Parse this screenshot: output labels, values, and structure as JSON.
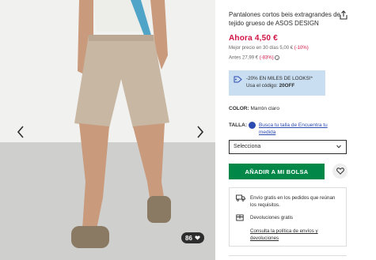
{
  "product": {
    "title": "Pantalones cortos beis extragrandes de tejido grueso de ASOS DESIGN",
    "price_now": "Ahora 4,50 €",
    "best_price_label": "Mejor precio en 30 días 5,00 € ",
    "best_price_pct": "(-10%)",
    "before_label": "Antes 27,99 € ",
    "before_pct": "(-83%)",
    "info_icon": "i"
  },
  "promo": {
    "text": "-20% EN MILES DE LOOKS!* Usa el código: ",
    "code": "20OFF",
    "icon": "tag-icon"
  },
  "color": {
    "label": "COLOR:",
    "value": "Marrón claro"
  },
  "size": {
    "label": "TALLA:",
    "fit_link": "Busca tu talla de Encuentra tu medida",
    "select_value": "Selecciona"
  },
  "actions": {
    "add_to_bag": "AÑADIR A MI BOLSA"
  },
  "delivery": {
    "free_shipping": "Envío gratis en los pedidos que reúnan los requisitos.",
    "free_returns": "Devoluciones gratis",
    "policy_link": "Consulta la política de envíos y devoluciones"
  },
  "gallery": {
    "likes": "86"
  },
  "colors": {
    "accent_red": "#d01345",
    "bag_green": "#018849",
    "promo_blue": "#c9def1",
    "link_blue": "#2c4bb0"
  }
}
